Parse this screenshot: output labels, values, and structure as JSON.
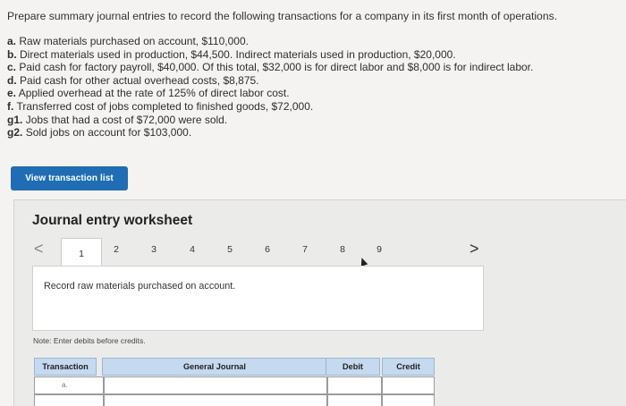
{
  "prompt": "Prepare summary journal entries to record the following transactions for a company in its first month of operations.",
  "transactions": [
    {
      "label": "a.",
      "text": "Raw materials purchased on account, $110,000."
    },
    {
      "label": "b.",
      "text": "Direct materials used in production, $44,500. Indirect materials used in production, $20,000."
    },
    {
      "label": "c.",
      "text": "Paid cash for factory payroll, $40,000. Of this total, $32,000 is for direct labor and $8,000 is for indirect labor."
    },
    {
      "label": "d.",
      "text": "Paid cash for other actual overhead costs, $8,875."
    },
    {
      "label": "e.",
      "text": "Applied overhead at the rate of 125% of direct labor cost."
    },
    {
      "label": "f.",
      "text": "Transferred cost of jobs completed to finished goods, $72,000."
    },
    {
      "label": "g1.",
      "text": "Jobs that had a cost of $72,000 were sold."
    },
    {
      "label": "g2.",
      "text": "Sold jobs on account for $103,000."
    }
  ],
  "view_button": "View transaction list",
  "worksheet": {
    "title": "Journal entry worksheet",
    "pages": [
      "1",
      "2",
      "3",
      "4",
      "5",
      "6",
      "7",
      "8",
      "9"
    ],
    "active_page": "1",
    "prev_glyph": "<",
    "next_glyph": ">",
    "description": "Record raw materials purchased on account.",
    "note": "Note: Enter debits before credits.",
    "table": {
      "headers": [
        "Transaction",
        "General Journal",
        "Debit",
        "Credit"
      ],
      "first_row_transaction": "a."
    }
  }
}
